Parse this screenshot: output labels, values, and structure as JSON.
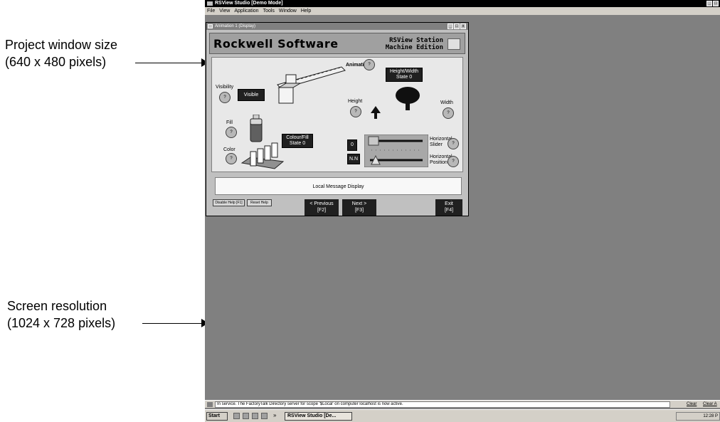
{
  "annotations": {
    "project_window_line1": "Project window size",
    "project_window_line2": "(640 x 480 pixels)",
    "screen_res_line1": "Screen resolution",
    "screen_res_line2": "(1024 x 728 pixels)"
  },
  "app": {
    "title": "RSView Studio   [Demo Mode]",
    "menu": [
      "File",
      "View",
      "Application",
      "Tools",
      "Window",
      "Help"
    ],
    "window_controls": [
      "_",
      "□"
    ]
  },
  "display": {
    "title": "Animation 1 (Display)",
    "window_controls": [
      "_",
      "□",
      "x"
    ],
    "brand_left": "Rockwell Software",
    "brand_right_1": "RSView Station",
    "brand_right_2": "Machine Edition",
    "animation_label": "Animation",
    "visibility_label": "Visibility",
    "visible_button": "Visible",
    "height_width_1": "Height/Width",
    "height_width_2": "State 0",
    "height_label": "Height",
    "width_label": "Width",
    "fill_label": "Fill",
    "color_label": "Color",
    "colour_fill_1": "Colour/Fill",
    "colour_fill_2": "State 0",
    "numeric_0": "0",
    "numeric_nn": "N.N",
    "horizontal_slider_1": "Horizontal",
    "horizontal_slider_2": "Slider",
    "horizontal_position_1": "Horizontal",
    "horizontal_position_2": "Position",
    "help_glyph": "?",
    "message": "Local Message Display",
    "disable_help": "Disable Help [F1]",
    "reset_help": "Reset Help",
    "prev_1": "< Previous",
    "prev_2": "[F2]",
    "next_1": "Next >",
    "next_2": "[F3]",
    "exit_1": "Exit",
    "exit_2": "[F4]"
  },
  "status": {
    "message": "In service. The FactoryTalk Directory server for scope '$Local' on computer localhost is now active.",
    "clear": "Clear",
    "clear_all": "Clear A"
  },
  "taskbar": {
    "start": "Start",
    "quicklaunch_more": "»",
    "task": "RSView Studio  [De...",
    "clock": "12:28 P"
  },
  "colors": {
    "desktop": "#808080",
    "title_bar": "#000000",
    "panel": "#e8e8e8",
    "dark_button": "#202020"
  }
}
